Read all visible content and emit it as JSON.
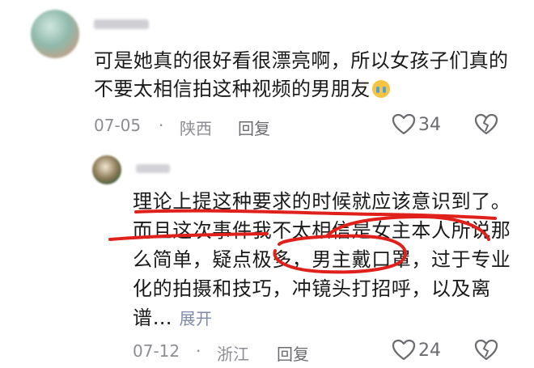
{
  "comments": [
    {
      "text": "可是她真的很好看很漂亮啊，所以女孩子们真的不要太相信拍这种视频的男朋友",
      "emoji_icon": "loudly-crying-face-icon",
      "date": "07-05",
      "location": "陕西",
      "reply_label": "回复",
      "likes": "34"
    },
    {
      "text": "理论上提这种要求的时候就应该意识到了。而且这次事件我不太相信是女主本人所说那么简单，疑点极多，男主戴口罩，过于专业化的拍摄和技巧，冲镜头打招呼，以及离谱…",
      "expand_label": "展开",
      "date": "07-12",
      "location": "浙江",
      "reply_label": "回复",
      "likes": "24"
    }
  ],
  "separator": "·",
  "colors": {
    "annotation": "#e0201b",
    "meta": "#8d8d93"
  }
}
